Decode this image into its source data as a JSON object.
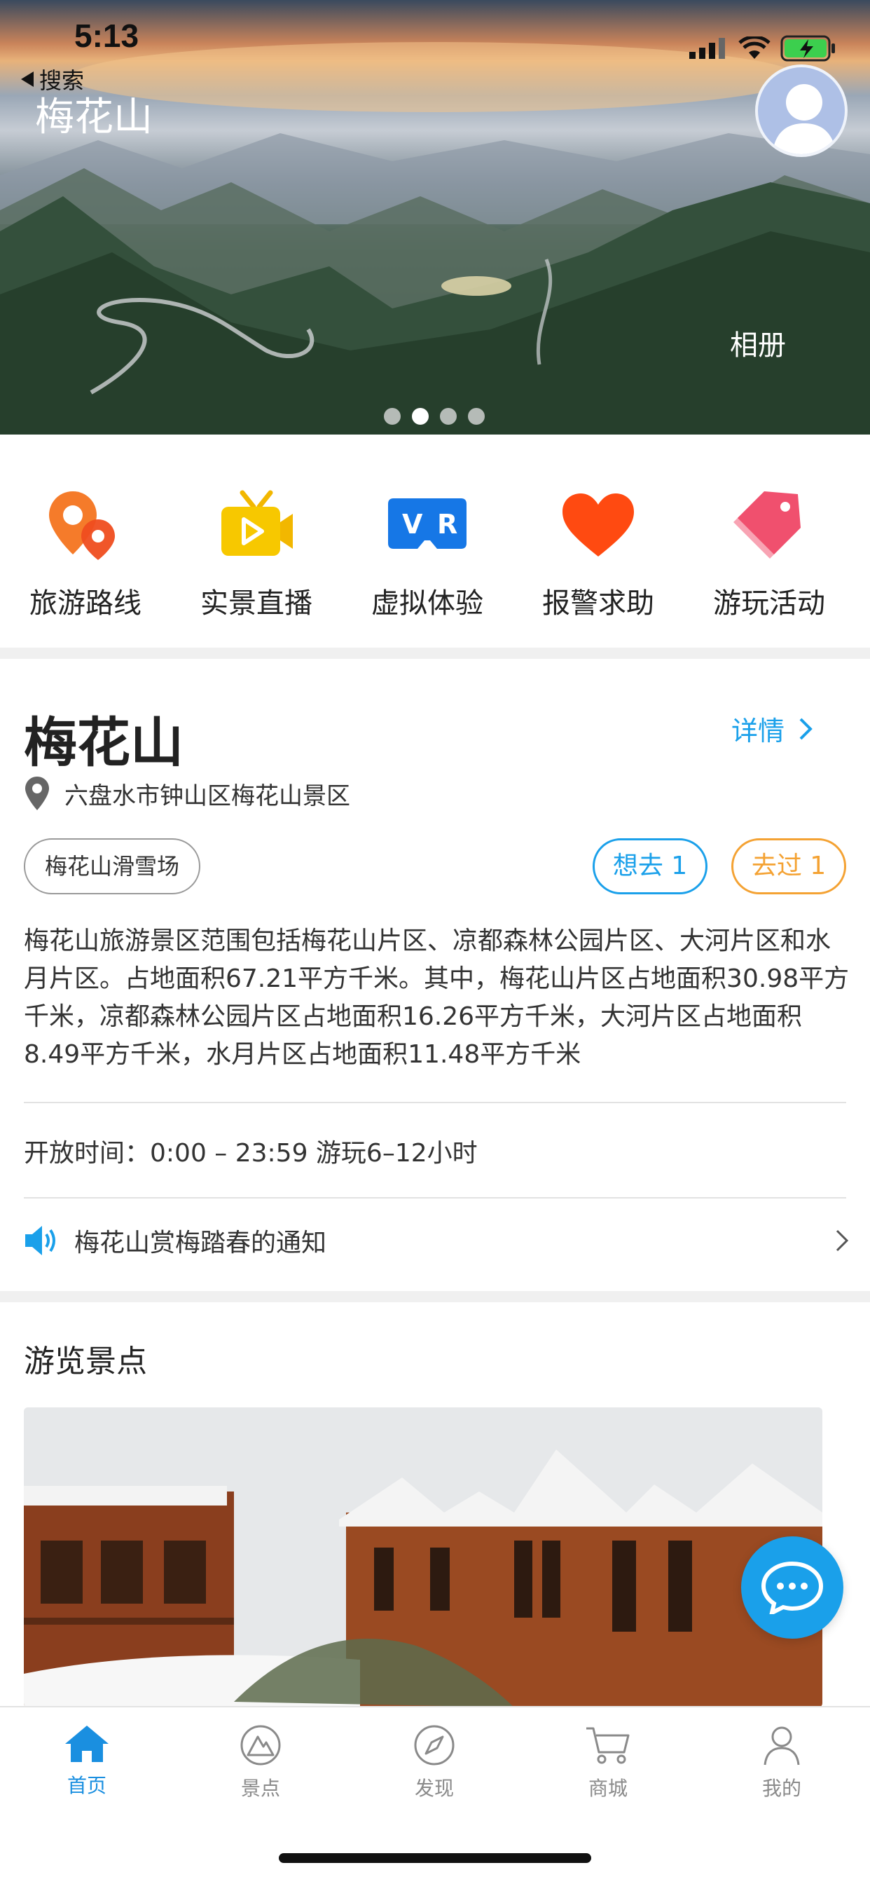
{
  "status": {
    "time": "5:13"
  },
  "hero": {
    "back_label": "搜索",
    "title": "梅花山",
    "album_label": "相册",
    "dot_count": 4,
    "active_dot": 1
  },
  "features": [
    {
      "label": "旅游路线",
      "icon": "map-pin-icon",
      "color": "#f26b21"
    },
    {
      "label": "实景直播",
      "icon": "video-camera-icon",
      "color": "#f7c500"
    },
    {
      "label": "虚拟体验",
      "icon": "vr-goggles-icon",
      "color": "#1677e6"
    },
    {
      "label": "报警求助",
      "icon": "heart-icon",
      "color": "#ff4a11"
    },
    {
      "label": "游玩活动",
      "icon": "tag-icon",
      "color": "#f0506e"
    }
  ],
  "info": {
    "title": "梅花山",
    "detail_label": "详情",
    "address": "六盘水市钟山区梅花山景区",
    "tag": "梅花山滑雪场",
    "want_label": "想去 1",
    "been_label": "去过 1",
    "description": "梅花山旅游景区范围包括梅花山片区、凉都森林公园片区、大河片区和水月片区。占地面积67.21平方千米。其中，梅花山片区占地面积30.98平方千米，凉都森林公园片区占地面积16.26平方千米，大河片区占地面积8.49平方千米，水月片区占地面积11.48平方千米",
    "hours": "开放时间：0:00 – 23:59 游玩6–12小时",
    "notice": "梅花山赏梅踏春的通知"
  },
  "section": {
    "title": "游览景点"
  },
  "tabs": [
    {
      "label": "首页",
      "icon": "home-icon",
      "active": true
    },
    {
      "label": "景点",
      "icon": "mountain-icon",
      "active": false
    },
    {
      "label": "发现",
      "icon": "compass-icon",
      "active": false
    },
    {
      "label": "商城",
      "icon": "cart-icon",
      "active": false
    },
    {
      "label": "我的",
      "icon": "user-icon",
      "active": false
    }
  ],
  "colors": {
    "accent": "#1aa0ea",
    "orange": "#f4a233",
    "tab_active": "#1a8fe0"
  }
}
